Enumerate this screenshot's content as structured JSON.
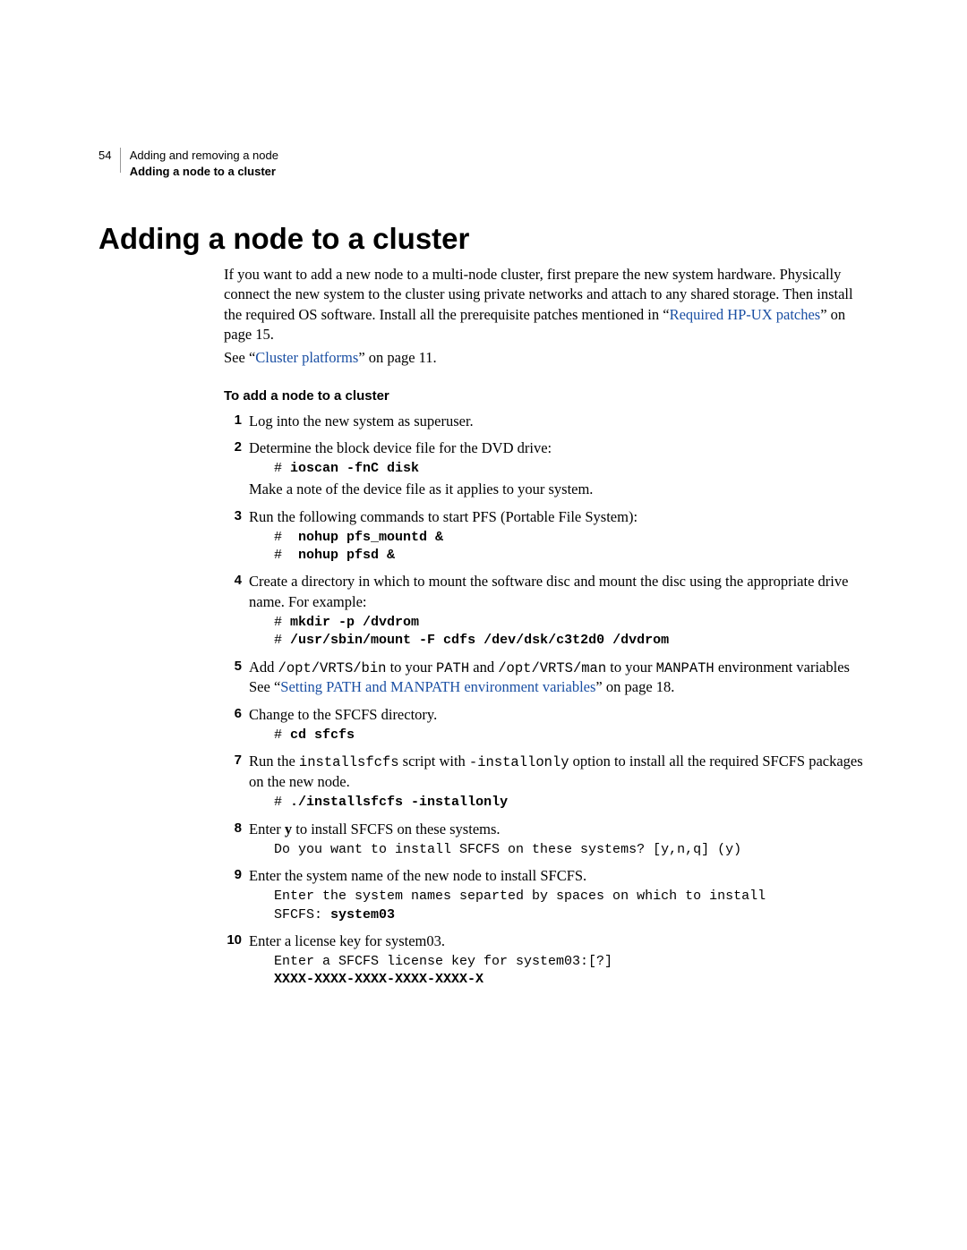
{
  "header": {
    "page_number": "54",
    "chapter": "Adding and removing a node",
    "section": "Adding a node to a cluster"
  },
  "title": "Adding a node to a cluster",
  "intro": {
    "p1a": "If you want to add a new node to a multi-node cluster, first prepare the new system hardware. Physically connect the new system to the cluster using private networks and attach to any shared storage. Then install the required OS software. Install all the prerequisite patches mentioned in “",
    "link1": "Required HP-UX patches",
    "p1b": "” on page 15.",
    "p2a": "See “",
    "link2": "Cluster platforms",
    "p2b": "” on page 11."
  },
  "subhead": "To add a node to a cluster",
  "steps": {
    "s1": "Log into the new system as superuser.",
    "s2a": "Determine the block device file for the DVD drive:",
    "s2code": "# ioscan -fnC disk",
    "s2b": "Make a note of the device file as it applies to your system.",
    "s3": "Run the following commands to start PFS (Portable File System):",
    "s3code1": "#  nohup pfs_mountd &",
    "s3code2": "#  nohup pfsd &",
    "s4": "Create a directory in which to mount the software disc and mount the disc using the appropriate drive name. For example:",
    "s4code1": "# mkdir -p /dvdrom",
    "s4code2": "# /usr/sbin/mount -F cdfs /dev/dsk/c3t2d0 /dvdrom",
    "s5a": "Add ",
    "s5m1": "/opt/VRTS/bin",
    "s5b": " to your ",
    "s5m2": "PATH",
    "s5c": " and ",
    "s5m3": "/opt/VRTS/man",
    "s5d": " to your ",
    "s5m4": "MANPATH",
    "s5e": " environment variables",
    "s5see_a": "See “",
    "s5link": "Setting PATH and MANPATH environment variables",
    "s5see_b": "” on page 18.",
    "s6": "Change to the SFCFS directory.",
    "s6code": "# cd sfcfs",
    "s7a": "Run the ",
    "s7m1": "installsfcfs",
    "s7b": " script with ",
    "s7m2": "-installonly",
    "s7c": " option to install all the required SFCFS packages on the new node.",
    "s7code": "# ./installsfcfs -installonly",
    "s8a": "Enter ",
    "s8bold": "y",
    "s8b": " to install SFCFS on these systems.",
    "s8code": "Do you want to install SFCFS on these systems? [y,n,q] (y)",
    "s9": "Enter the system name of the new node to install SFCFS.",
    "s9code_a": "Enter the system names separted by spaces on which to install\nSFCFS: ",
    "s9code_b": "system03",
    "s10": "Enter a license key for system03.",
    "s10code_a": "Enter a SFCFS license key for system03:[?]",
    "s10code_b": "XXXX-XXXX-XXXX-XXXX-XXXX-X"
  }
}
